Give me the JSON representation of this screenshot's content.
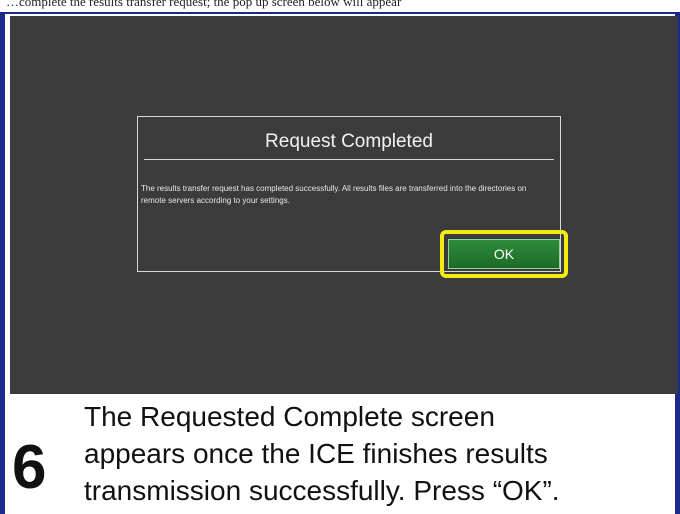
{
  "header_caption": "…complete the results transfer request; the pop up screen below will appear",
  "dialog": {
    "title": "Request Completed",
    "message": "The results transfer request has completed successfully. All results files are transferred into the directories on remote servers according to your settings.",
    "ok_label": "OK"
  },
  "step": {
    "number": "6",
    "lines": [
      "The Requested Complete screen",
      "appears once the ICE finishes results",
      "transmission successfully. Press “OK”."
    ]
  },
  "colors": {
    "frame_border": "#1a2a8a",
    "screen_background": "#3b3b3b",
    "highlight": "#f2ea12",
    "ok_button": "#2a7d33"
  }
}
